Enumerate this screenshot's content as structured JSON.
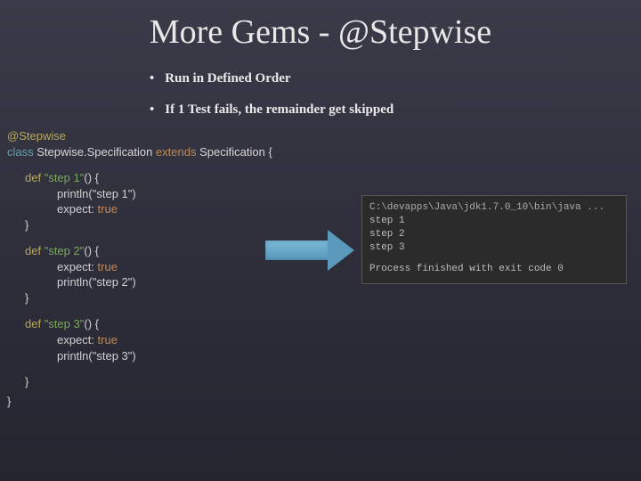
{
  "title": "More Gems - @Stepwise",
  "bullets": [
    "Run in Defined Order",
    "If 1 Test fails, the remainder get skipped"
  ],
  "code": {
    "annotation": "@Stepwise",
    "class_kw": "class",
    "class_name": "Stepwise.Specification",
    "extends_kw": "extends",
    "extends_name": "Specification",
    "open": "{",
    "close": "}",
    "def_kw": "def",
    "expect_label": "expect:",
    "true_kw": "true",
    "methods": [
      {
        "name": "\"step 1\"",
        "println_full": "println(\"step 1\")",
        "order": "print_first"
      },
      {
        "name": "\"step 2\"",
        "println_full": "println(\"step 2\")",
        "order": "expect_first"
      },
      {
        "name": "\"step 3\"",
        "println_full": "println(\"step 3\")",
        "order": "expect_first"
      }
    ]
  },
  "console": {
    "path": "C:\\devapps\\Java\\jdk1.7.0_10\\bin\\java ...",
    "lines": [
      "step 1",
      "step 2",
      "step 3"
    ],
    "exit": "Process finished with exit code 0"
  }
}
